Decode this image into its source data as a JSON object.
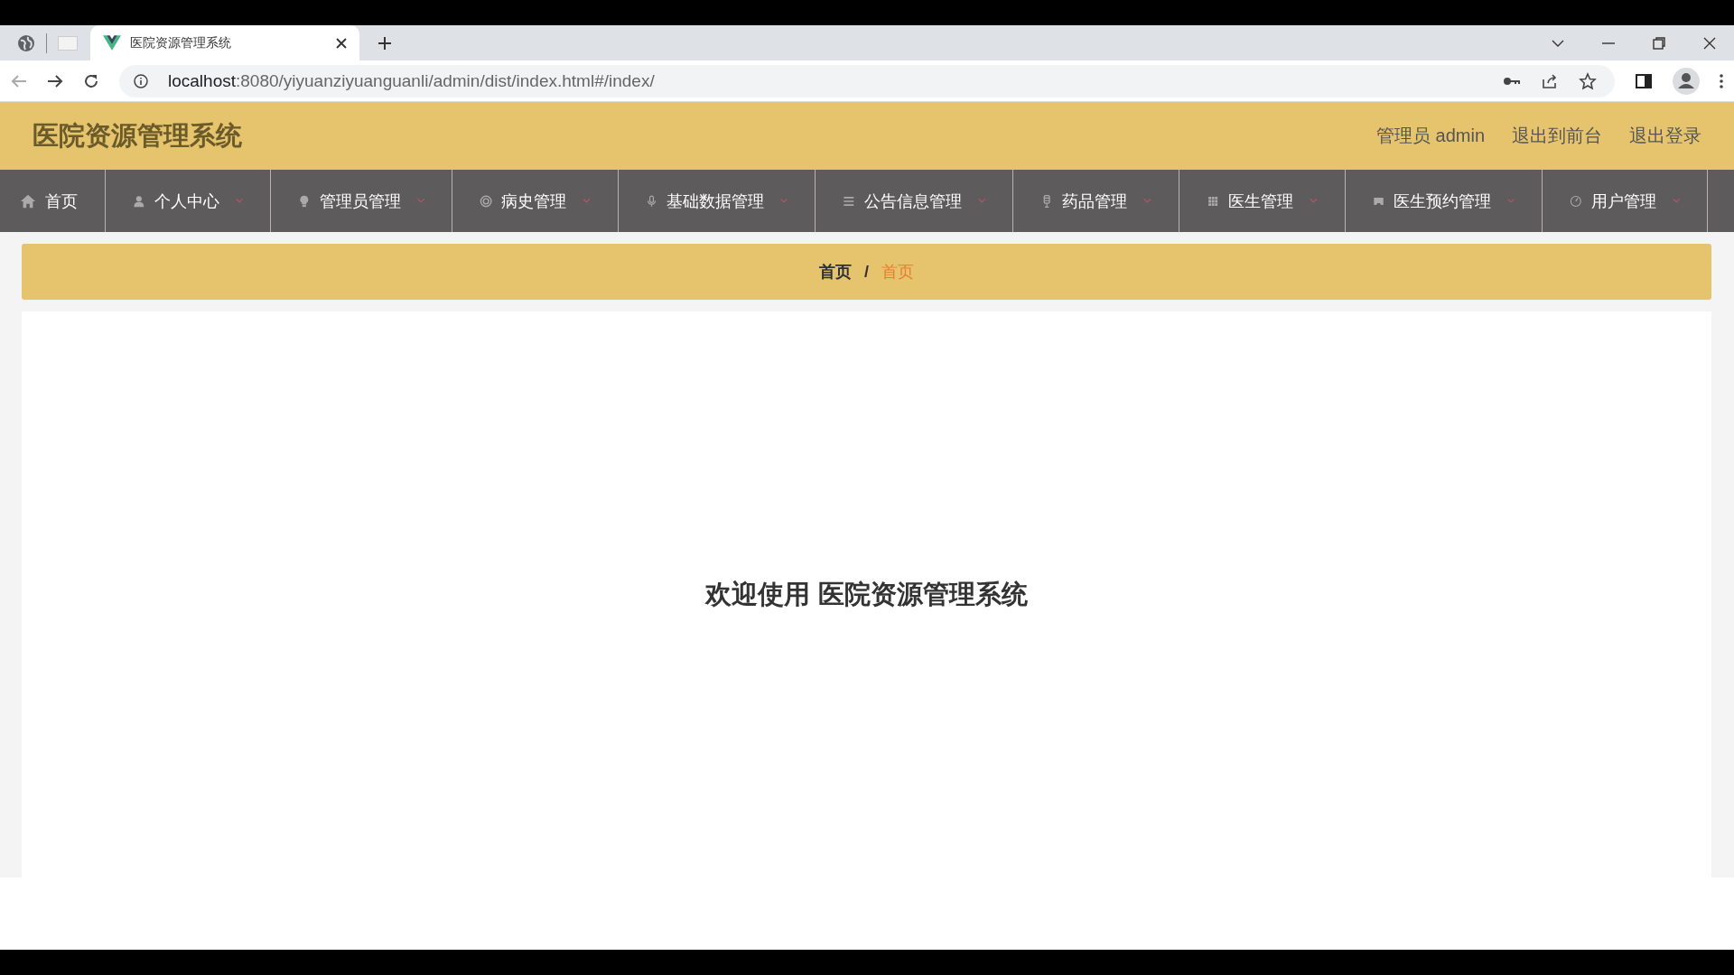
{
  "browser": {
    "tab_title": "医院资源管理系统",
    "url_host": "localhost",
    "url_path": ":8080/yiyuanziyuanguanli/admin/dist/index.html#/index/"
  },
  "header": {
    "title": "医院资源管理系统",
    "user": "管理员 admin",
    "links": [
      "退出到前台",
      "退出登录"
    ]
  },
  "nav": [
    {
      "label": "首页",
      "dropdown": false
    },
    {
      "label": "个人中心",
      "dropdown": true
    },
    {
      "label": "管理员管理",
      "dropdown": true
    },
    {
      "label": "病史管理",
      "dropdown": true
    },
    {
      "label": "基础数据管理",
      "dropdown": true
    },
    {
      "label": "公告信息管理",
      "dropdown": true
    },
    {
      "label": "药品管理",
      "dropdown": true
    },
    {
      "label": "医生管理",
      "dropdown": true
    },
    {
      "label": "医生预约管理",
      "dropdown": true
    },
    {
      "label": "用户管理",
      "dropdown": true
    }
  ],
  "breadcrumb": [
    {
      "label": "首页",
      "selected": false
    },
    {
      "label": "首页",
      "selected": true
    }
  ],
  "breadcrumb_separator": "/",
  "welcome": "欢迎使用 医院资源管理系统"
}
